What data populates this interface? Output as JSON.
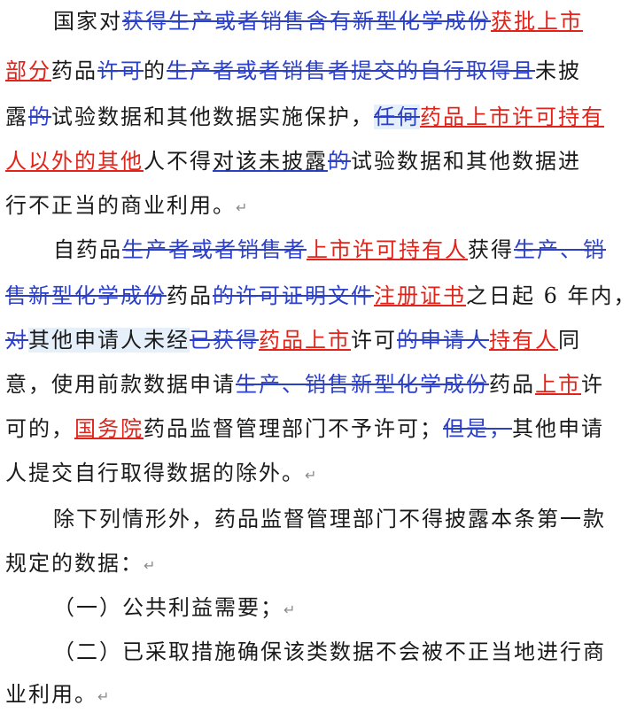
{
  "doc": {
    "lines": [
      {
        "segs": [
          {
            "t": "国家对"
          },
          {
            "t": "获得生产或者销售含有新型化学成份",
            "s": "del"
          },
          {
            "t": "获批上市",
            "s": "ins"
          }
        ]
      },
      {
        "segs": [
          {
            "t": "部分",
            "s": "ins"
          },
          {
            "t": "药品"
          },
          {
            "t": "许可",
            "s": "del"
          },
          {
            "t": "的"
          },
          {
            "t": "生产者或者销售者提交的自行取得且",
            "s": "del"
          },
          {
            "t": "未披"
          }
        ]
      },
      {
        "segs": [
          {
            "t": "露"
          },
          {
            "t": "的",
            "s": "del"
          },
          {
            "t": "试验数据和其他数据实施保护，"
          },
          {
            "t": "任何",
            "s": "del cmt"
          },
          {
            "t": "药品上市许可持有",
            "s": "ins"
          }
        ]
      },
      {
        "segs": [
          {
            "t": "人以外的其他",
            "s": "ins"
          },
          {
            "t": "人不得"
          },
          {
            "t": "对该未披露",
            "s": "wavy"
          },
          {
            "t": "的",
            "s": "del"
          },
          {
            "t": "试验数据和其他数据进"
          }
        ]
      },
      {
        "segs": [
          {
            "t": "行不正当的商业利用。"
          },
          {
            "t": "↵",
            "s": "mark"
          }
        ]
      },
      {
        "segs": [
          {
            "t": "自药品"
          },
          {
            "t": "生产者或者销售者",
            "s": "del"
          },
          {
            "t": "上市许可持有人",
            "s": "ins"
          },
          {
            "t": "获得"
          },
          {
            "t": "生产、销",
            "s": "del"
          }
        ]
      },
      {
        "segs": [
          {
            "t": "售新型化学成份",
            "s": "del"
          },
          {
            "t": "药品"
          },
          {
            "t": "的许可证明文件",
            "s": "del"
          },
          {
            "t": "注册证书",
            "s": "ins"
          },
          {
            "t": "之日起 6 年内，"
          }
        ]
      },
      {
        "segs": [
          {
            "t": "对",
            "s": "del"
          },
          {
            "t": "其他申请人未经",
            "s": "cmt"
          },
          {
            "t": "已获得",
            "s": "del"
          },
          {
            "t": "药品上市",
            "s": "ins"
          },
          {
            "t": "许可"
          },
          {
            "t": "的申请人",
            "s": "del"
          },
          {
            "t": "持有人",
            "s": "ins"
          },
          {
            "t": "同"
          }
        ]
      },
      {
        "segs": [
          {
            "t": "意，使用前款数据申请"
          },
          {
            "t": "生产、销售新型化学成份",
            "s": "del"
          },
          {
            "t": "药品"
          },
          {
            "t": "上市",
            "s": "ins"
          },
          {
            "t": "许"
          }
        ]
      },
      {
        "segs": [
          {
            "t": "可的，"
          },
          {
            "t": "国务院",
            "s": "ins"
          },
          {
            "t": "药品监督管理部门不予许可；"
          },
          {
            "t": "但是，",
            "s": "del"
          },
          {
            "t": "其他申请"
          }
        ]
      },
      {
        "segs": [
          {
            "t": "人提交自行取得数据的除外。"
          },
          {
            "t": "↵",
            "s": "mark"
          }
        ]
      },
      {
        "segs": [
          {
            "t": "除下列情形外，药品监督管理部门不得披露本条第一款"
          }
        ]
      },
      {
        "segs": [
          {
            "t": "规定的数据："
          },
          {
            "t": "↵",
            "s": "mark"
          }
        ]
      },
      {
        "segs": [
          {
            "t": "（一）公共利益需要；"
          },
          {
            "t": "↵",
            "s": "mark"
          }
        ]
      },
      {
        "segs": [
          {
            "t": "（二）已采取措施确保该类数据不会被不正当地进行商"
          }
        ]
      },
      {
        "segs": [
          {
            "t": "业利用。"
          },
          {
            "t": "↵",
            "s": "mark"
          }
        ]
      }
    ]
  },
  "colors": {
    "deletion": "#2b3fc7",
    "insertion": "#e2231a",
    "comment_highlight": "#e6f0fb"
  }
}
